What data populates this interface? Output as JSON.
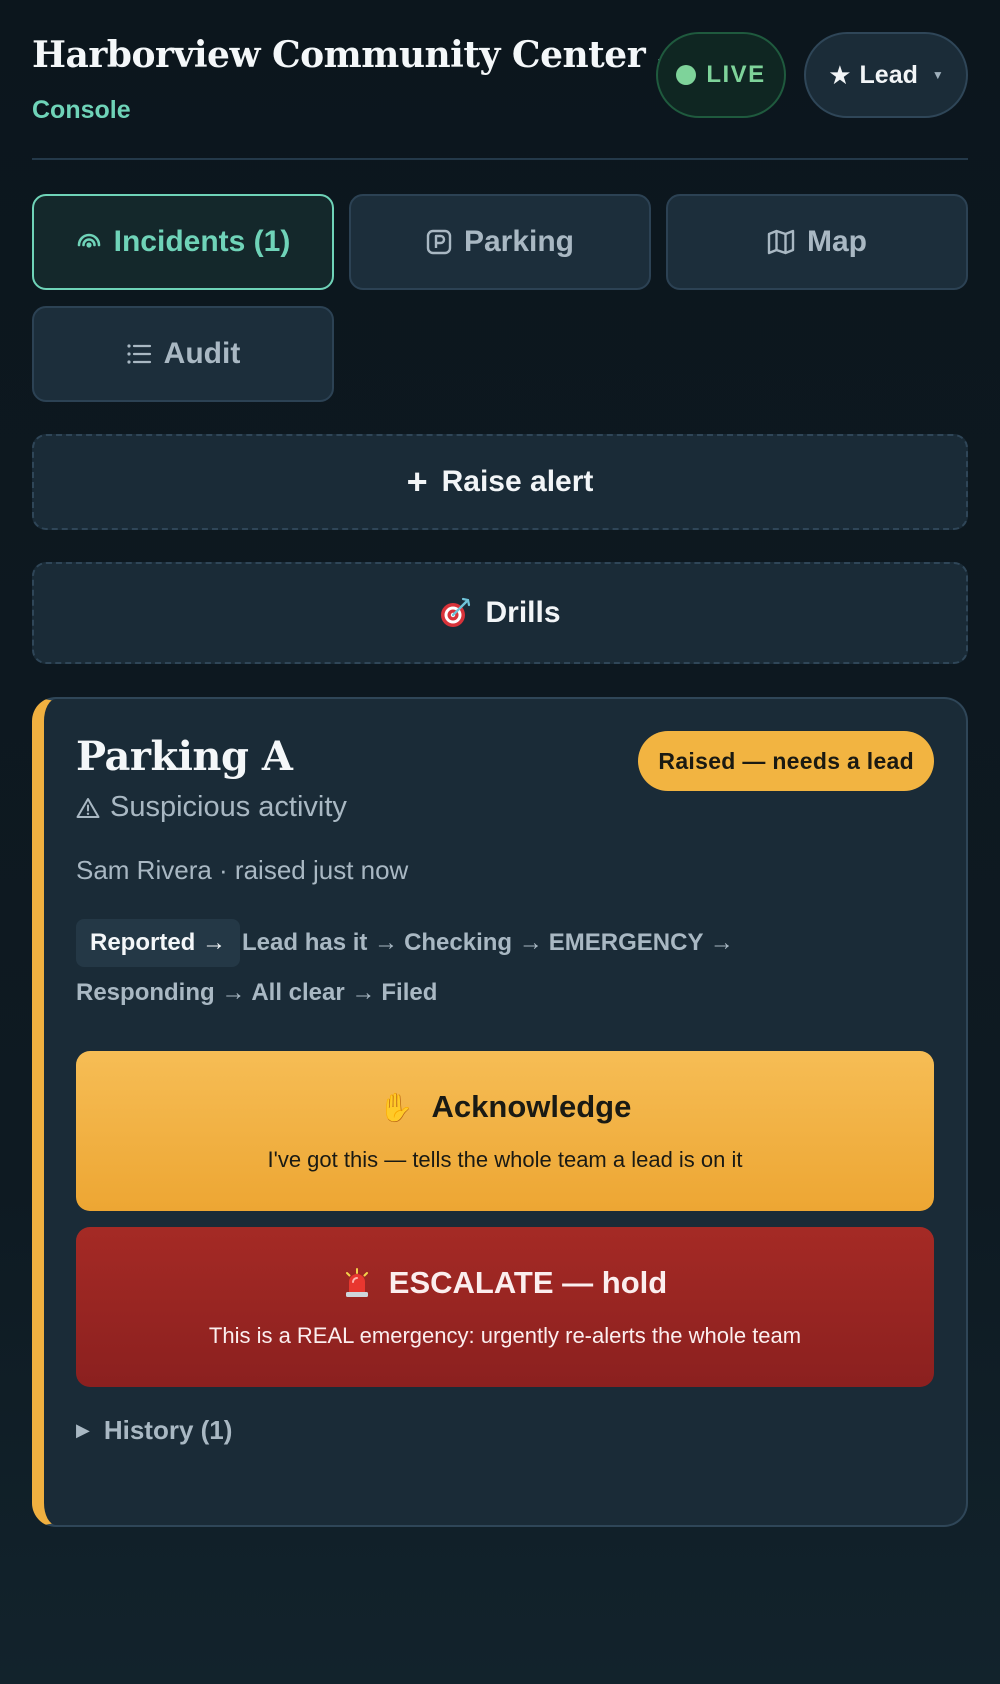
{
  "header": {
    "title": "Harborview Community Center",
    "subtitle": "Console",
    "live_label": "LIVE",
    "role_label": "Lead",
    "accent_color": "#6fd3b8"
  },
  "tabs": [
    {
      "label": "Incidents (1)",
      "icon": "broadcast-icon",
      "active": true
    },
    {
      "label": "Parking",
      "icon": "parking-icon",
      "active": false
    },
    {
      "label": "Map",
      "icon": "map-icon",
      "active": false
    },
    {
      "label": "Audit",
      "icon": "list-icon",
      "active": false
    }
  ],
  "actions": {
    "raise_alert": "Raise alert",
    "drills": "Drills"
  },
  "incident": {
    "location": "Parking A",
    "type": "Suspicious activity",
    "status": "Raised — needs a lead",
    "status_color": "#f2b441",
    "meta": "Sam Rivera · raised just now",
    "stages": [
      {
        "label": "Reported →",
        "current": true
      },
      {
        "label": "Lead has it →",
        "current": false
      },
      {
        "label": "Checking →",
        "current": false
      },
      {
        "label": "EMERGENCY →",
        "current": false
      },
      {
        "label": "Responding →",
        "current": false
      },
      {
        "label": "All clear →",
        "current": false
      },
      {
        "label": "Filed",
        "current": false
      }
    ],
    "acknowledge": {
      "label": "Acknowledge",
      "hint": "I've got this — tells the whole team a lead is on it",
      "icon": "raised-hand-icon",
      "color": "#f2b441"
    },
    "escalate": {
      "label": "ESCALATE — hold",
      "hint": "This is a REAL emergency: urgently re-alerts the whole team",
      "icon": "siren-icon",
      "color": "#9b2522"
    },
    "history_label": "History (1)"
  }
}
